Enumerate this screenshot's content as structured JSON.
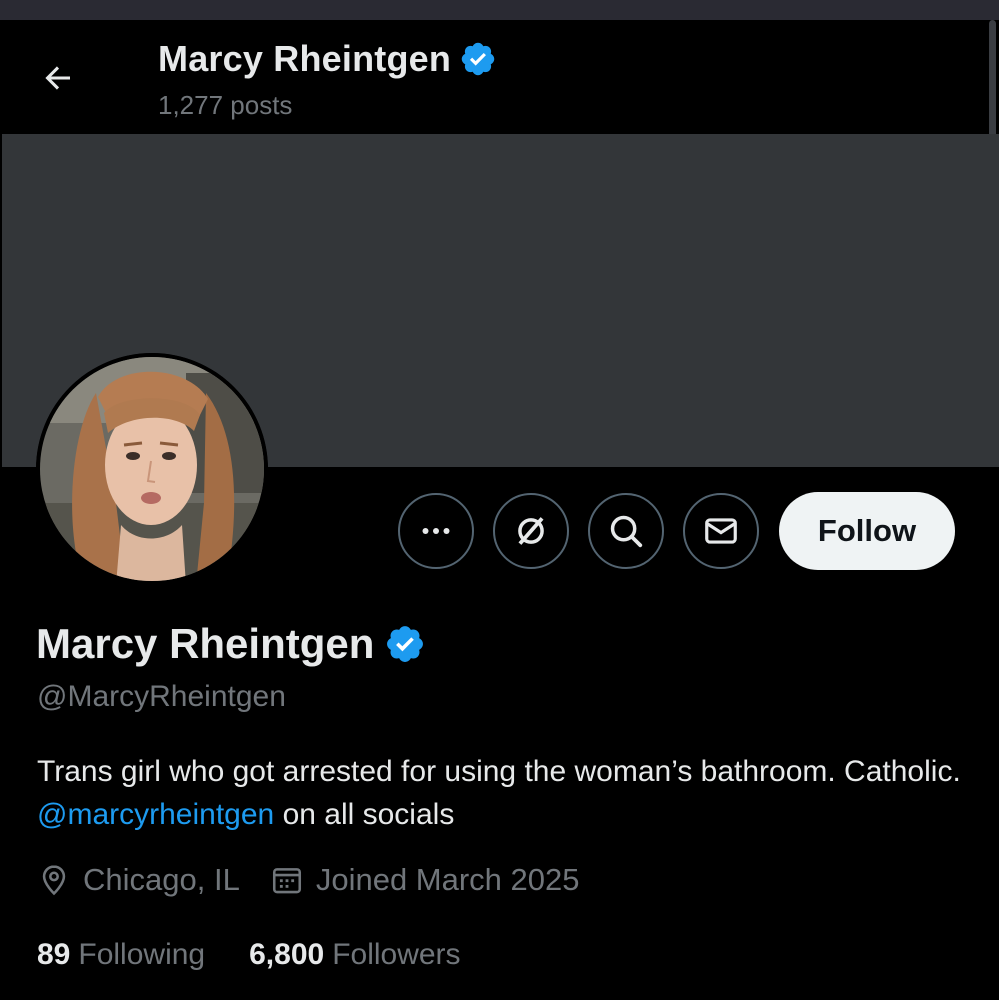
{
  "header": {
    "name": "Marcy Rheintgen",
    "posts": "1,277 posts"
  },
  "actions": {
    "more_icon": "more-horizontal-icon",
    "grok_icon": "grok-icon",
    "search_icon": "search-icon",
    "message_icon": "mail-icon",
    "follow_label": "Follow"
  },
  "profile": {
    "name": "Marcy Rheintgen",
    "handle": "@MarcyRheintgen",
    "bio_text": "Trans girl who got arrested for using the woman’s bathroom. Catholic.",
    "bio_mention": "@marcyrheintgen",
    "bio_suffix": "on all socials",
    "location": "Chicago, IL",
    "joined": "Joined March 2025",
    "following_count": "89",
    "following_label": "Following",
    "followers_count": "6,800",
    "followers_label": "Followers"
  },
  "colors": {
    "background": "#000000",
    "banner": "#333639",
    "verified": "#1d9bf0",
    "link": "#1d9bf0",
    "secondary_text": "#71767b",
    "primary_text": "#e7e9ea",
    "follow_button_bg": "#eff3f4"
  }
}
